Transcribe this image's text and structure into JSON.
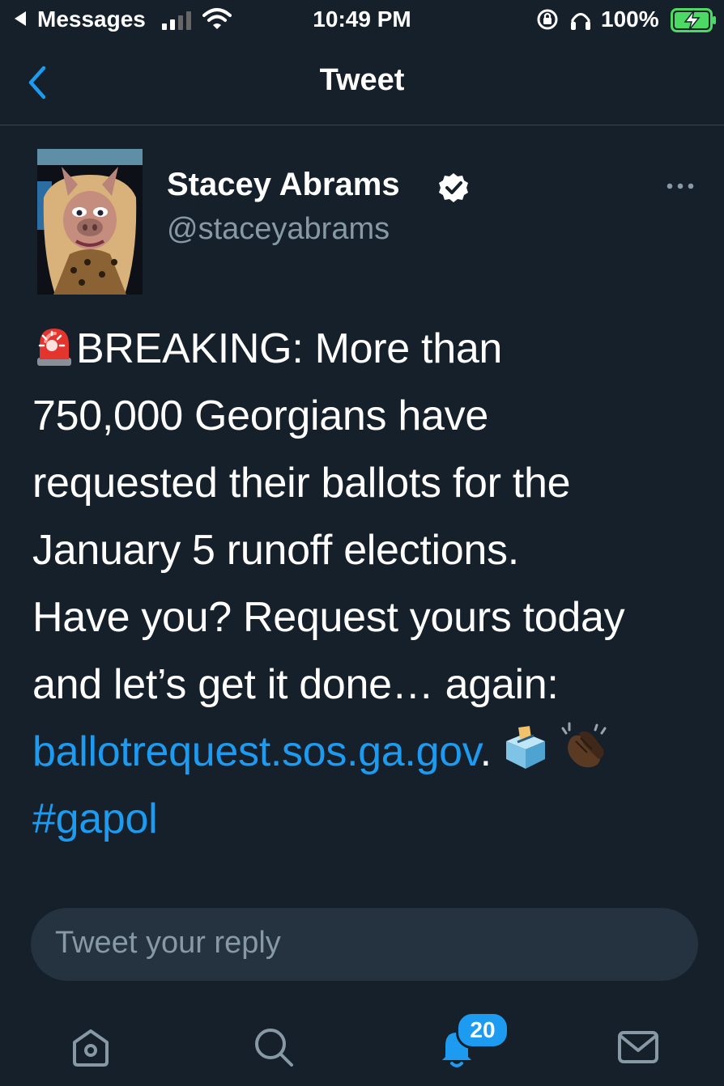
{
  "status_bar": {
    "back_app": "Messages",
    "time": "10:49 PM",
    "battery": "100%"
  },
  "nav": {
    "title": "Tweet"
  },
  "tweet": {
    "author_name": "Stacey Abrams",
    "handle": "@staceyabrams",
    "lines": {
      "l1": "BREAKING: More than",
      "l2": "750,000 Georgians have",
      "l3": "requested their ballots for the",
      "l4": "January 5 runoff elections.",
      "l5": "Have you? Request yours today",
      "l6": "and let’s get it done… again:"
    },
    "link": "ballotrequest.sos.ga.gov",
    "after_link": ".",
    "hashtag": "#gapol",
    "emojis": [
      "police-light",
      "ballot-box",
      "clapping-hands"
    ]
  },
  "reply": {
    "placeholder": "Tweet your reply"
  },
  "tabbar": {
    "notifications_badge": "20",
    "icons": [
      "home-icon",
      "search-icon",
      "bell-icon",
      "mail-icon"
    ]
  },
  "colors": {
    "background": "#15202b",
    "link": "#1d9bf0",
    "secondary_text": "#8899a6",
    "battery_charging": "#4cd964"
  }
}
